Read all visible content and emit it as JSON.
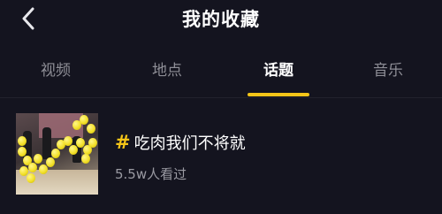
{
  "header": {
    "title": "我的收藏",
    "back_icon": "chevron-left-icon"
  },
  "tabs": [
    {
      "label": "视频",
      "active": false
    },
    {
      "label": "地点",
      "active": false
    },
    {
      "label": "话题",
      "active": true
    },
    {
      "label": "音乐",
      "active": false
    }
  ],
  "colors": {
    "background": "#14141f",
    "accent": "#f5c518",
    "inactive_tab": "#8e8e96"
  },
  "topics": [
    {
      "hash": "#",
      "name": "吃肉我们不将就",
      "views": "5.5w人看过",
      "thumbnail_icon": "topic-thumbnail-image"
    }
  ]
}
